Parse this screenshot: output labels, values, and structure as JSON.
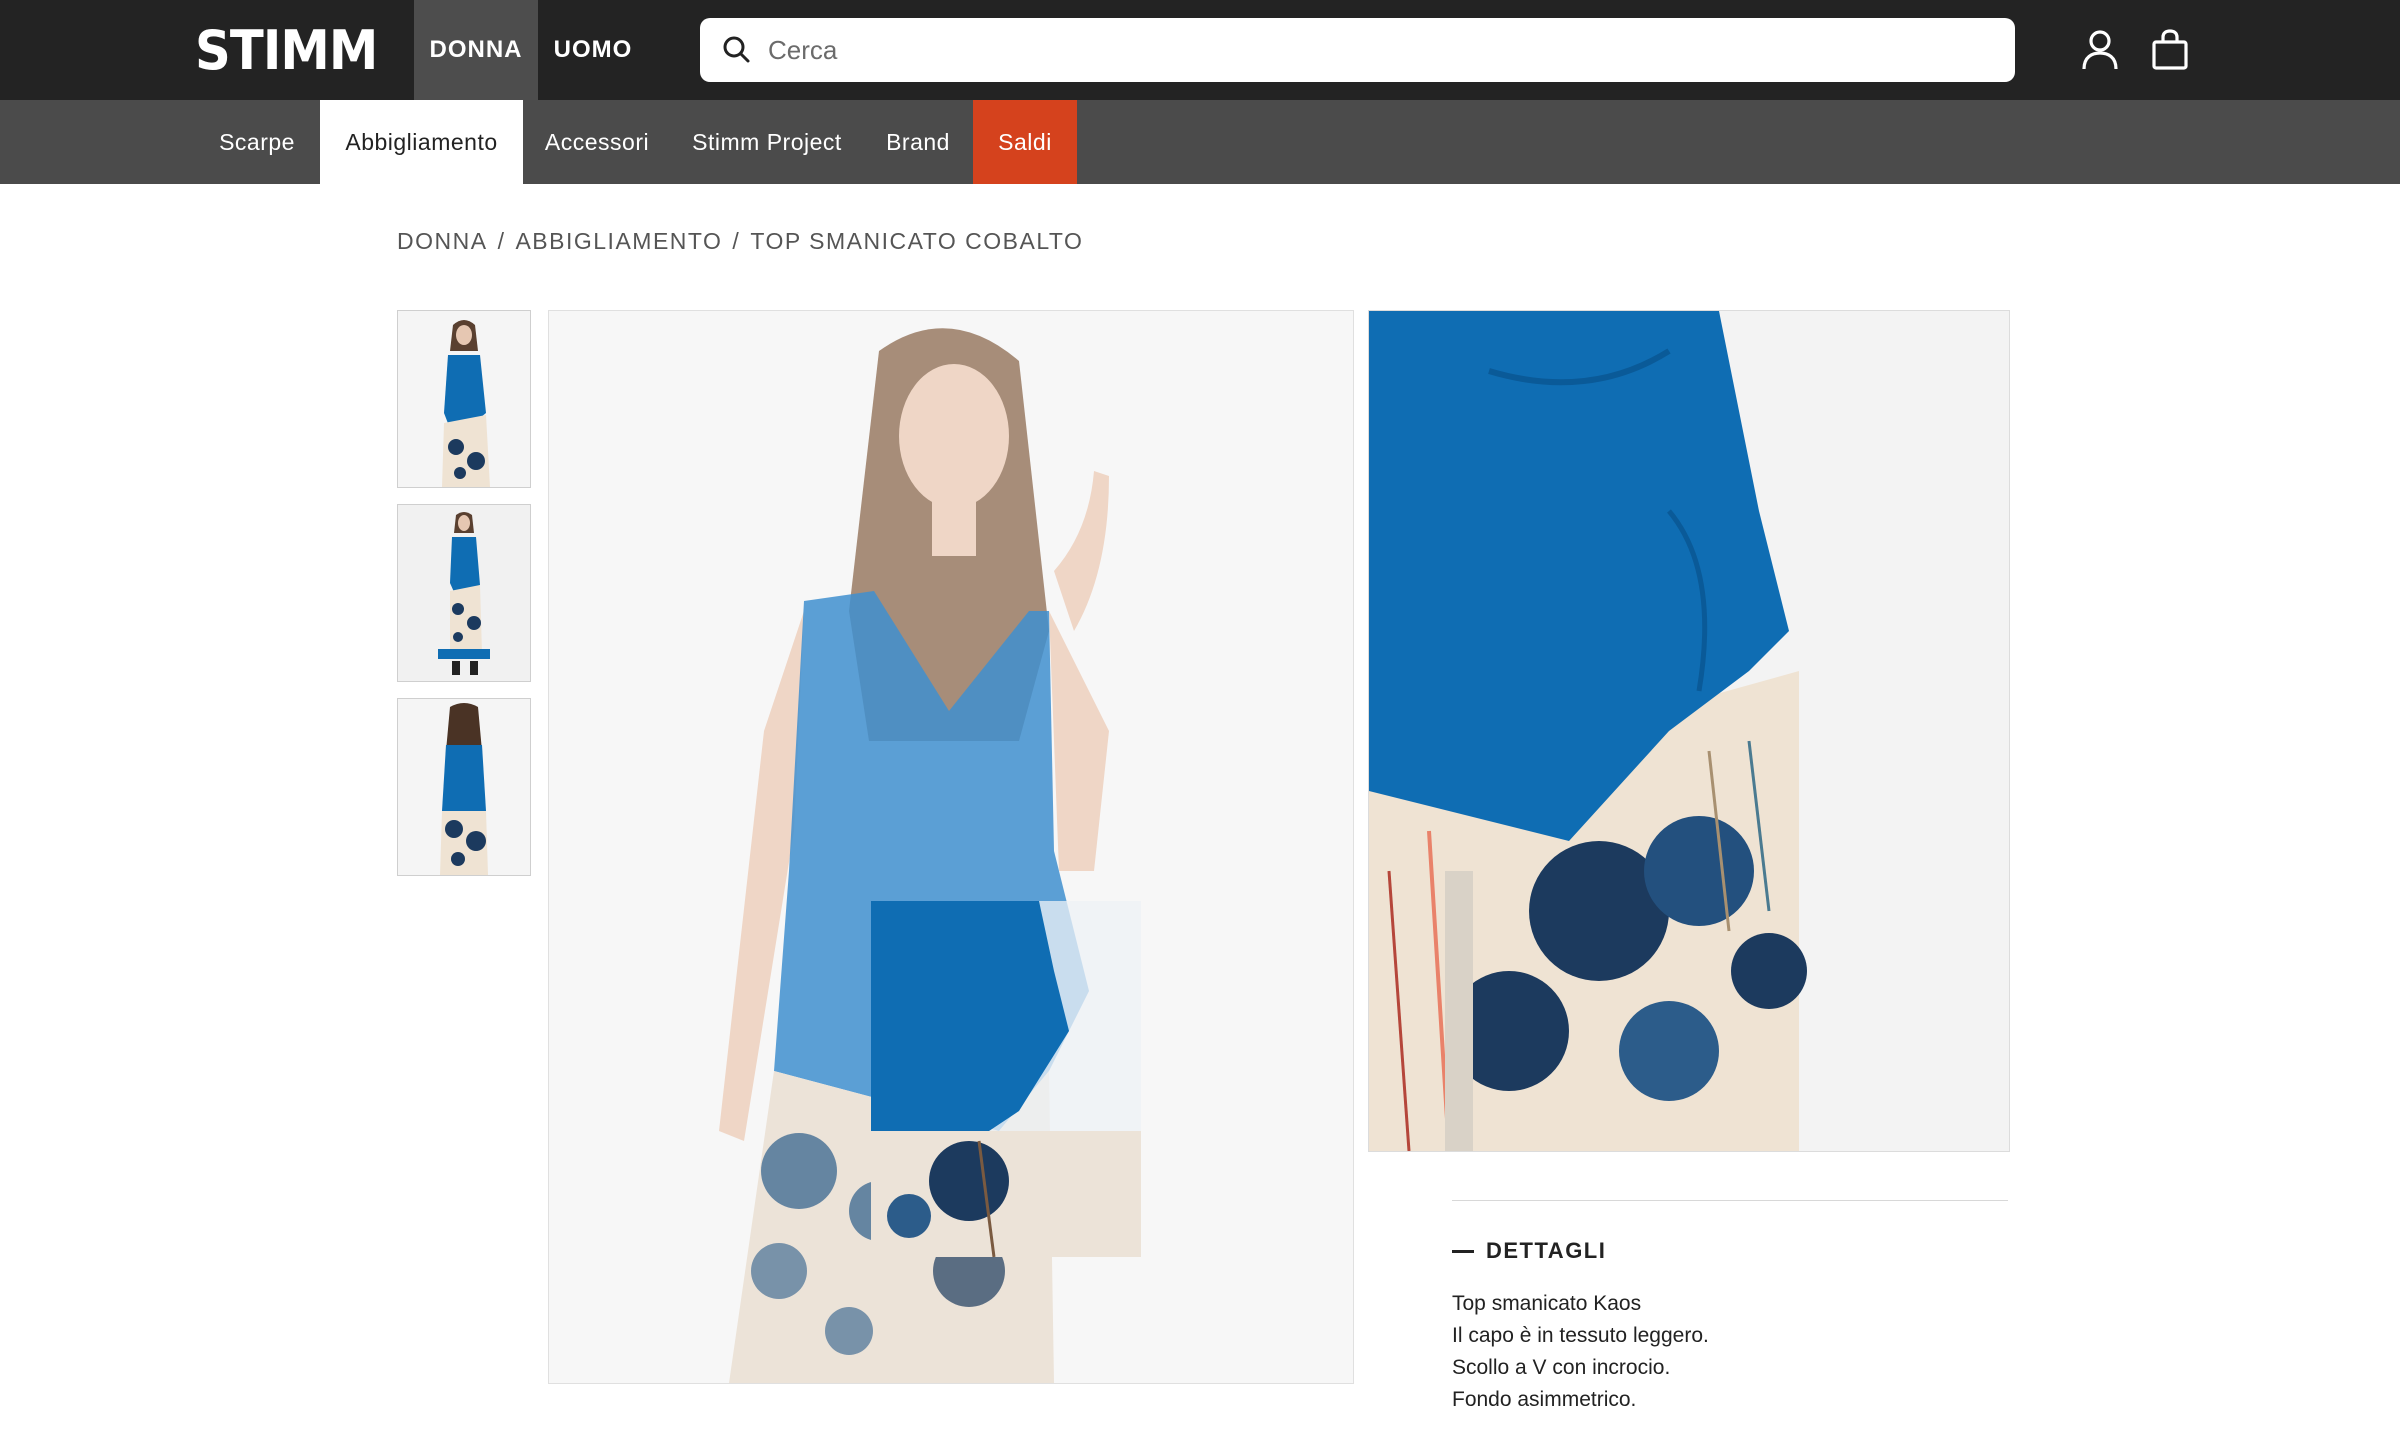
{
  "header": {
    "logo": "STIMM",
    "genders": [
      {
        "label": "DONNA",
        "active": true
      },
      {
        "label": "UOMO",
        "active": false
      }
    ],
    "search": {
      "placeholder": "Cerca",
      "value": ""
    },
    "icons": [
      "user-icon",
      "shopping-bag-icon"
    ],
    "colors": {
      "topbar": "#232323",
      "active_gender": "#4d4d4d"
    }
  },
  "categories": [
    {
      "label": "Scarpe",
      "active": false
    },
    {
      "label": "Abbigliamento",
      "active": true
    },
    {
      "label": "Accessori",
      "active": false
    },
    {
      "label": "Stimm Project",
      "active": false
    },
    {
      "label": "Brand",
      "active": false
    },
    {
      "label": "Saldi",
      "active": false,
      "highlight": "#d5421d"
    }
  ],
  "breadcrumb": {
    "items": [
      "DONNA",
      "ABBIGLIAMENTO",
      "TOP SMANICATO COBALTO"
    ],
    "separator": "/"
  },
  "product": {
    "thumbnails": [
      "thumbnail-front",
      "thumbnail-full",
      "thumbnail-back"
    ],
    "colors": {
      "top": "#0f6db3",
      "print_dark": "#1c3a5e",
      "print_light": "#efe3d3"
    }
  },
  "details": {
    "title": "DETTAGLI",
    "lines": [
      "Top smanicato Kaos",
      "Il capo è in tessuto leggero.",
      "Scollo a V con incrocio.",
      "Fondo asimmetrico."
    ]
  }
}
